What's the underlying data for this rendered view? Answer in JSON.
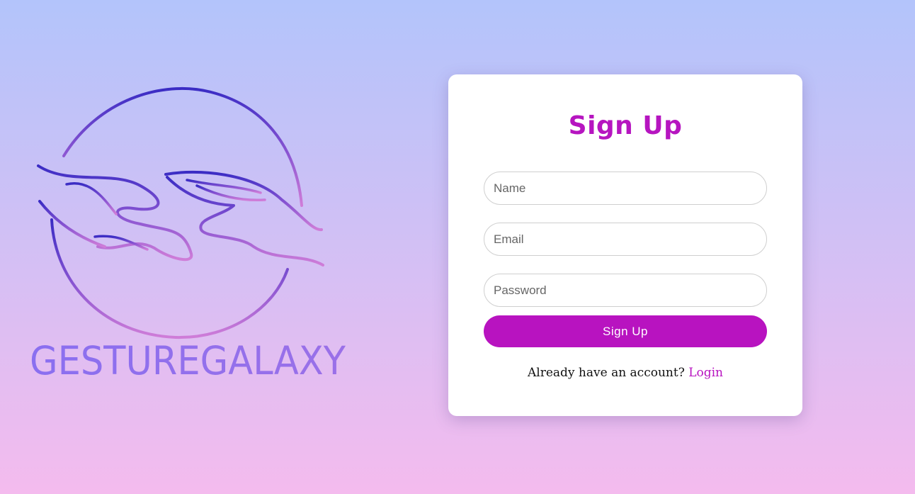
{
  "brand": {
    "name": "GESTUREGALAXY"
  },
  "signup": {
    "title": "Sign Up",
    "name_placeholder": "Name",
    "email_placeholder": "Email",
    "password_placeholder": "Password",
    "submit_label": "Sign Up",
    "login_prompt": "Already have an account?",
    "login_link": "Login"
  },
  "colors": {
    "accent": "#b813c0",
    "logo_blue": "#3f2fc7",
    "logo_pink": "#c77bd9",
    "background_top": "#b3c4fb",
    "background_bottom": "#f4bbee"
  },
  "icons": {
    "logo": "hands-circle-logo"
  }
}
